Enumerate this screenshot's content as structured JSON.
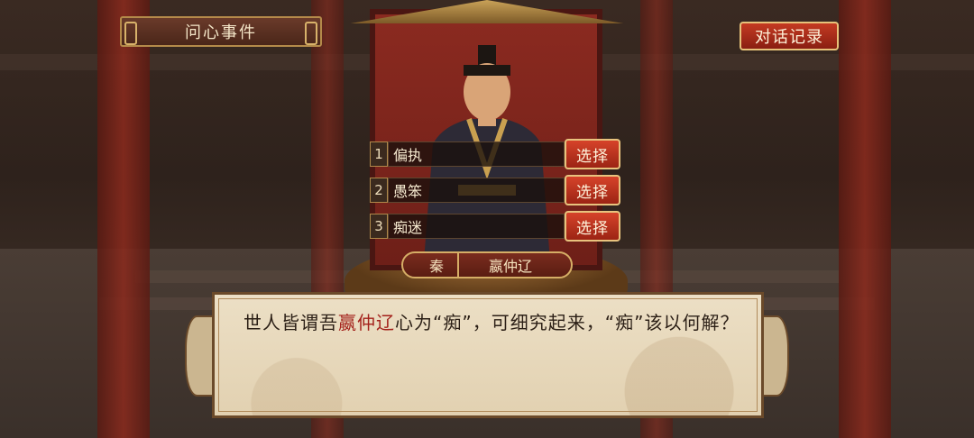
{
  "header": {
    "title": "问心事件"
  },
  "log_button": {
    "label": "对话记录"
  },
  "options": [
    {
      "number": "1",
      "text": "偏执",
      "button": "选择"
    },
    {
      "number": "2",
      "text": "愚笨",
      "button": "选择"
    },
    {
      "number": "3",
      "text": "痴迷",
      "button": "选择"
    }
  ],
  "nameplate": {
    "state": "秦",
    "name": "嬴仲辽"
  },
  "dialog": {
    "before": "世人皆谓吾",
    "highlight": "嬴仲辽",
    "after": "心为“痴”，可细究起来，“痴”该以何解？"
  },
  "colors": {
    "accent": "#9c2414",
    "highlight": "#a3201a",
    "gold": "#e8c37e"
  }
}
